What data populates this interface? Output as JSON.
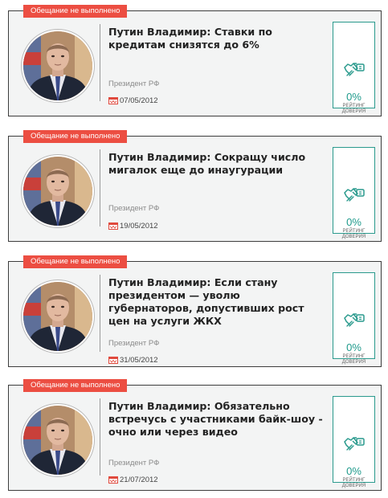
{
  "promises": [
    {
      "status": "Обещание не выполнено",
      "title": "Путин Владимир: Ставки по кредитам снизятся до 6%",
      "role": "Президент РФ",
      "date": "07/05/2012",
      "rating_value": "0%",
      "rating_label": "РЕЙТИНГ ДОВЕРИЯ"
    },
    {
      "status": "Обещание не выполнено",
      "title": "Путин Владимир: Сокращу число мигалок еще до инаугурации",
      "role": "Президент РФ",
      "date": "19/05/2012",
      "rating_value": "0%",
      "rating_label": "РЕЙТИНГ ДОВЕРИЯ"
    },
    {
      "status": "Обещание не выполнено",
      "title": "Путин Владимир: Если стану президентом — уволю губернаторов, допустивших рост цен на услуги ЖКХ",
      "role": "Президент РФ",
      "date": "31/05/2012",
      "rating_value": "0%",
      "rating_label": "РЕЙТИНГ ДОВЕРИЯ"
    },
    {
      "status": "Обещание не выполнено",
      "title": "Путин Владимир: Обязательно встречусь с участниками байк-шоу - очно или через видео",
      "role": "Президент РФ",
      "date": "21/07/2012",
      "rating_value": "0%",
      "rating_label": "РЕЙТИНГ ДОВЕРИЯ"
    }
  ],
  "colors": {
    "badge": "#ec4e42",
    "accent": "#1e9a8b",
    "card_border": "#3d3d3d",
    "card_background": "#f3f4f4"
  },
  "icons": {
    "avatar": "politician-portrait",
    "date": "calendar-icon",
    "rating": "handshake-icon"
  }
}
